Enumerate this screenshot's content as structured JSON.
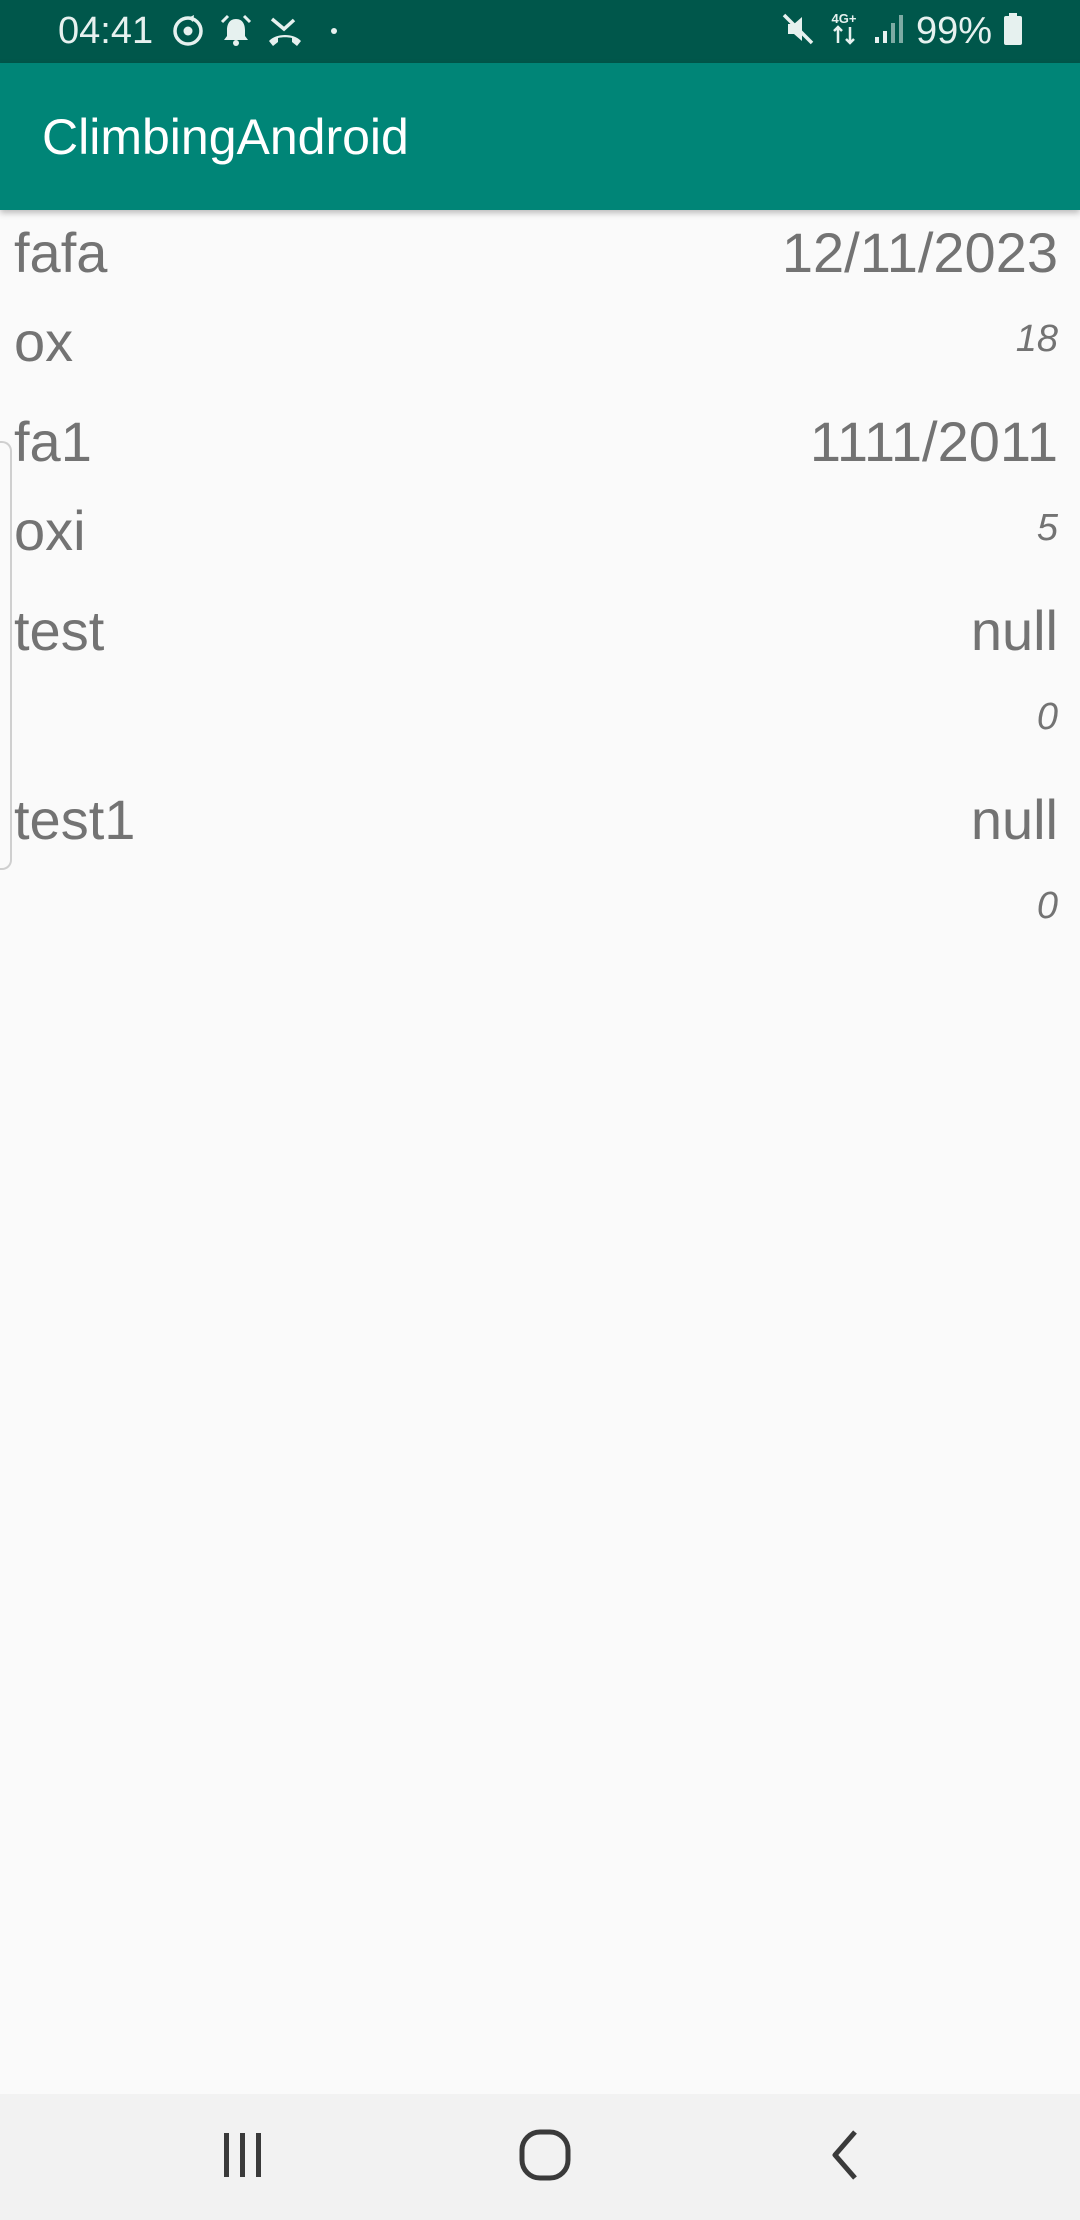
{
  "status_bar": {
    "time": "04:41",
    "battery": "99%",
    "network": "4G+",
    "icons": [
      "sync-icon",
      "alarm-icon",
      "missed-call-icon",
      "dot-icon",
      "mute-icon",
      "network-4g-icon",
      "signal-icon",
      "battery-icon"
    ]
  },
  "app_bar": {
    "title": "ClimbingAndroid"
  },
  "items": [
    {
      "name": "fafa",
      "date": "12/11/2023",
      "sub": "ox",
      "num": "18"
    },
    {
      "name": "fa1",
      "date": "1111/2011",
      "sub": "oxi",
      "num": "5"
    },
    {
      "name": "test",
      "date": "null",
      "sub": "",
      "num": "0"
    },
    {
      "name": "test1",
      "date": "null",
      "sub": "",
      "num": "0"
    }
  ],
  "nav_bar": {
    "icons": [
      "recents-icon",
      "home-icon",
      "back-icon"
    ]
  },
  "colors": {
    "status_bar": "#00574b",
    "app_bar": "#008577",
    "background": "#fafafa",
    "text": "#737373",
    "nav_bar": "#f2f2f2"
  }
}
